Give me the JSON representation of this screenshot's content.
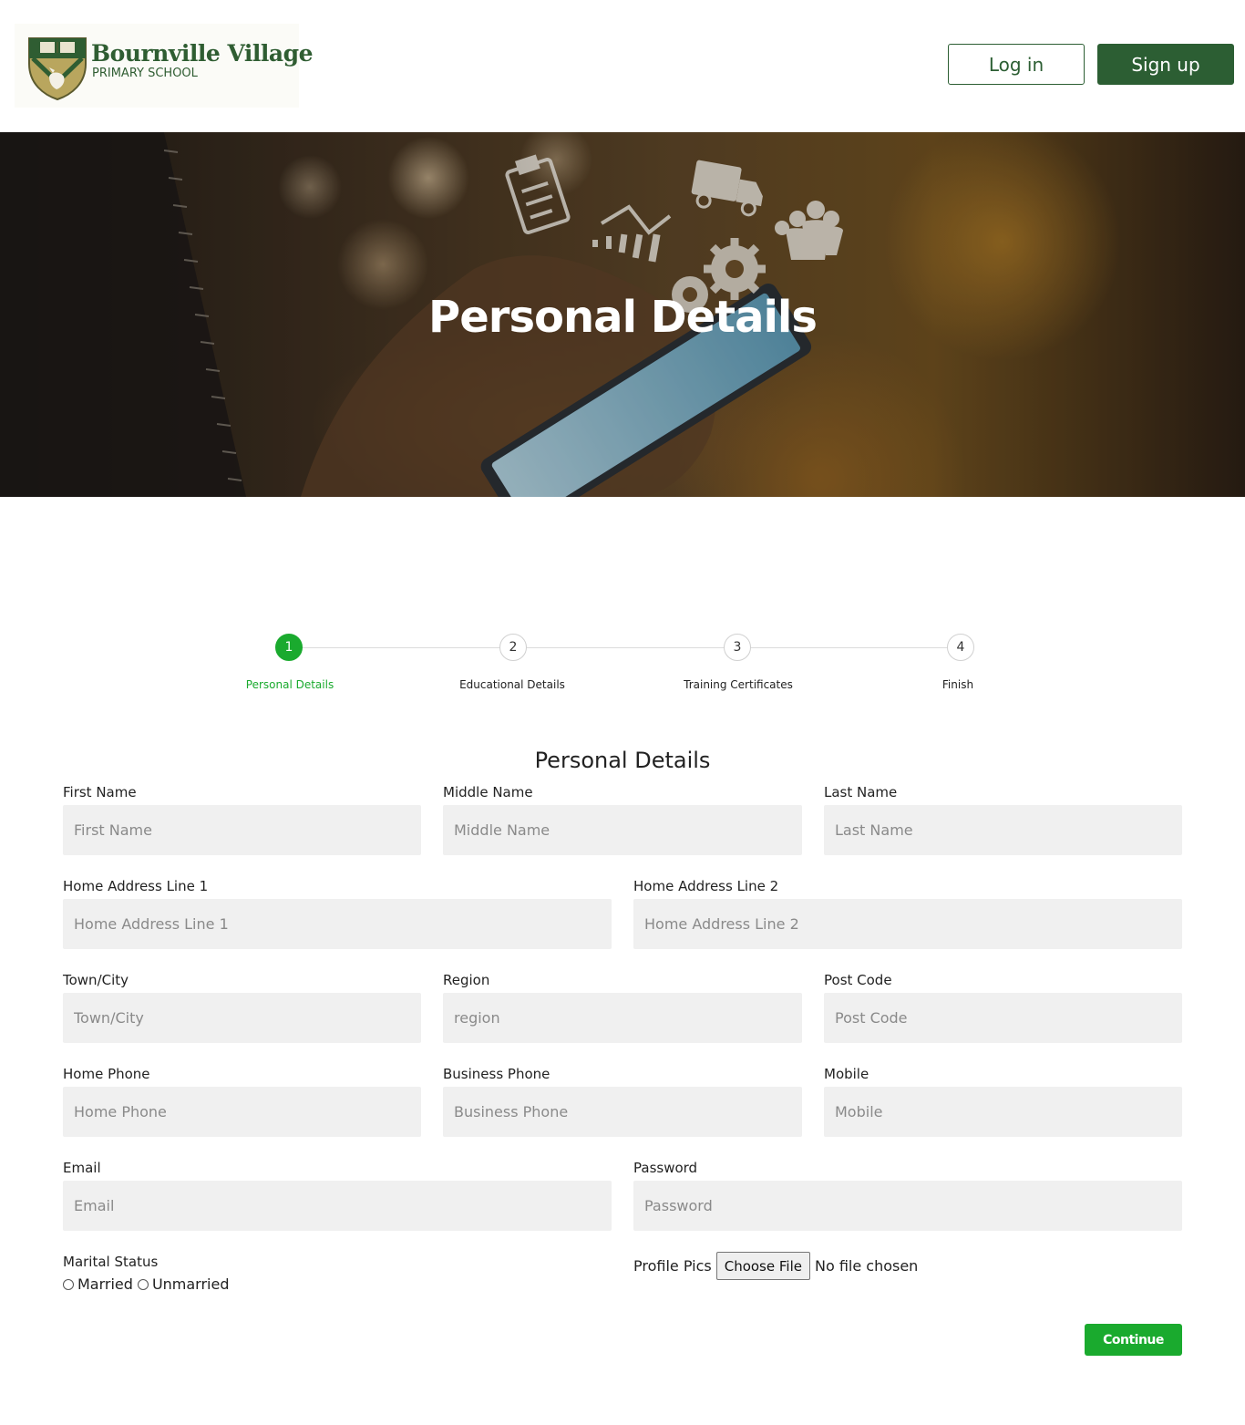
{
  "header": {
    "logo": {
      "title": "Bournville Village",
      "subtitle": "PRIMARY SCHOOL"
    },
    "login_label": "Log in",
    "signup_label": "Sign up"
  },
  "hero": {
    "title": "Personal Details"
  },
  "stepper": {
    "steps": [
      {
        "number": "1",
        "label": "Personal Details",
        "active": true
      },
      {
        "number": "2",
        "label": "Educational Details",
        "active": false
      },
      {
        "number": "3",
        "label": "Training Certificates",
        "active": false
      },
      {
        "number": "4",
        "label": "Finish",
        "active": false
      }
    ]
  },
  "form": {
    "title": "Personal Details",
    "fields": {
      "first_name": {
        "label": "First Name",
        "placeholder": "First Name",
        "value": ""
      },
      "middle_name": {
        "label": "Middle Name",
        "placeholder": "Middle Name",
        "value": ""
      },
      "last_name": {
        "label": "Last Name",
        "placeholder": "Last Name",
        "value": ""
      },
      "address1": {
        "label": "Home Address Line 1",
        "placeholder": "Home Address Line 1",
        "value": ""
      },
      "address2": {
        "label": "Home Address Line 2",
        "placeholder": "Home Address Line 2",
        "value": ""
      },
      "town": {
        "label": "Town/City",
        "placeholder": "Town/City",
        "value": ""
      },
      "region": {
        "label": "Region",
        "placeholder": "region",
        "value": ""
      },
      "postcode": {
        "label": "Post Code",
        "placeholder": "Post Code",
        "value": ""
      },
      "home_phone": {
        "label": "Home Phone",
        "placeholder": "Home Phone",
        "value": ""
      },
      "business_phone": {
        "label": "Business Phone",
        "placeholder": "Business Phone",
        "value": ""
      },
      "mobile": {
        "label": "Mobile",
        "placeholder": "Mobile",
        "value": ""
      },
      "email": {
        "label": "Email",
        "placeholder": "Email",
        "value": ""
      },
      "password": {
        "label": "Password",
        "placeholder": "Password",
        "value": ""
      }
    },
    "marital": {
      "label": "Marital Status",
      "options": [
        "Married",
        "Unmarried"
      ]
    },
    "profile": {
      "label": "Profile Pics",
      "button": "Choose File",
      "status": "No file chosen"
    },
    "continue_label": "Continue"
  },
  "colors": {
    "brand_dark_green": "#2c5e33",
    "accent_green": "#1aaa2e",
    "input_bg": "#f0f0f0"
  },
  "icons": [
    "school-crest-icon",
    "clipboard-icon",
    "bar-chart-icon",
    "truck-icon",
    "gears-icon",
    "people-group-icon"
  ]
}
